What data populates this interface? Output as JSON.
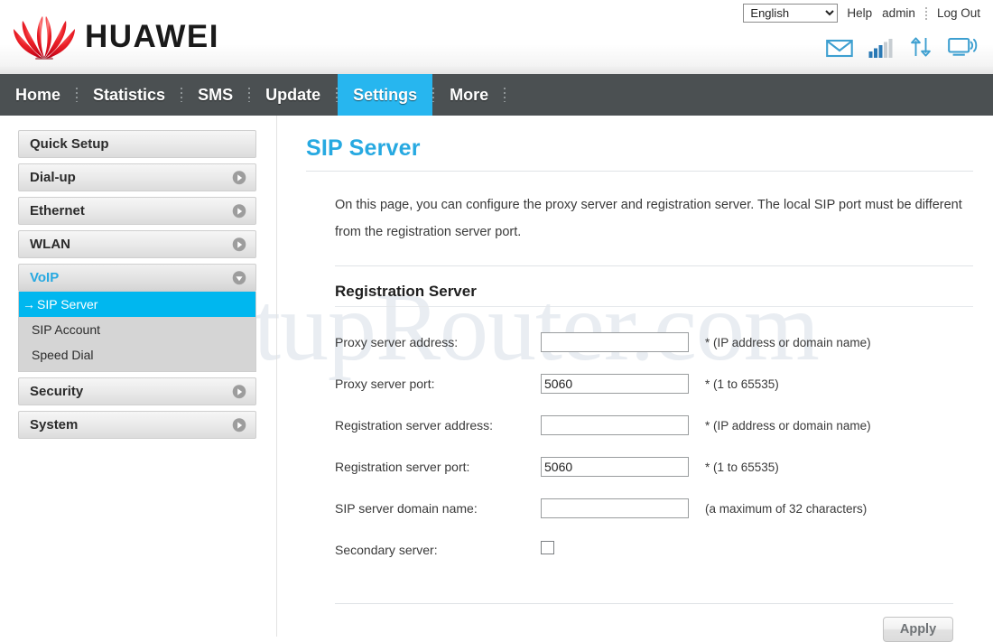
{
  "brand": {
    "name": "HUAWEI",
    "logo_icon": "huawei-flower-logo",
    "logo_color": "#e2001a"
  },
  "header": {
    "language": {
      "selected": "English",
      "options": [
        "English"
      ]
    },
    "links": [
      {
        "label": "Help",
        "name": "help-link"
      },
      {
        "label": "admin",
        "name": "user-link"
      },
      {
        "label": "Log Out",
        "name": "logout-link"
      }
    ],
    "status_icons": [
      {
        "name": "mail-icon",
        "title": "SMS"
      },
      {
        "name": "signal-bars-icon",
        "title": "Signal",
        "bars_total": 5,
        "bars_filled": 3
      },
      {
        "name": "data-transfer-icon",
        "title": "Data transfer"
      },
      {
        "name": "connection-monitor-icon",
        "title": "Connection"
      }
    ]
  },
  "nav": {
    "items": [
      {
        "label": "Home",
        "active": false
      },
      {
        "label": "Statistics",
        "active": false
      },
      {
        "label": "SMS",
        "active": false
      },
      {
        "label": "Update",
        "active": false
      },
      {
        "label": "Settings",
        "active": true
      },
      {
        "label": "More",
        "active": false
      }
    ],
    "active_color": "#27b6ef",
    "bar_color": "#4b5052"
  },
  "sidebar": {
    "items": [
      {
        "label": "Quick Setup",
        "state": "plain"
      },
      {
        "label": "Dial-up",
        "state": "collapsed"
      },
      {
        "label": "Ethernet",
        "state": "collapsed"
      },
      {
        "label": "WLAN",
        "state": "collapsed"
      },
      {
        "label": "VoIP",
        "state": "expanded"
      },
      {
        "label": "Security",
        "state": "collapsed"
      },
      {
        "label": "System",
        "state": "collapsed"
      }
    ],
    "voip_submenu": [
      {
        "label": "SIP Server",
        "selected": true,
        "arrow": "→"
      },
      {
        "label": "SIP Account",
        "selected": false,
        "arrow": "→"
      },
      {
        "label": "Speed Dial",
        "selected": false,
        "arrow": "→"
      }
    ],
    "selected_color": "#00b7ef",
    "expanded_color": "#27a9e1"
  },
  "main": {
    "page_title": "SIP Server",
    "intro": "On this page, you can configure the proxy server and registration server. The local SIP port must be different from the registration server port.",
    "section_title": "Registration Server",
    "fields": [
      {
        "label": "Proxy server address:",
        "type": "text",
        "value": "",
        "hint": "* (IP address or domain name)",
        "name": "proxy-server-address-input"
      },
      {
        "label": "Proxy server port:",
        "type": "text",
        "value": "5060",
        "hint": "* (1 to 65535)",
        "name": "proxy-server-port-input"
      },
      {
        "label": "Registration server address:",
        "type": "text",
        "value": "",
        "hint": "* (IP address or domain name)",
        "name": "registration-server-address-input"
      },
      {
        "label": "Registration server port:",
        "type": "text",
        "value": "5060",
        "hint": "* (1 to 65535)",
        "name": "registration-server-port-input"
      },
      {
        "label": "SIP server domain name:",
        "type": "text",
        "value": "",
        "hint": "(a maximum of 32 characters)",
        "name": "sip-server-domain-name-input"
      },
      {
        "label": "Secondary server:",
        "type": "checkbox",
        "checked": false,
        "hint": "",
        "name": "secondary-server-checkbox"
      }
    ],
    "apply_label": "Apply"
  },
  "watermark": {
    "text": "SetupRouter.com"
  }
}
